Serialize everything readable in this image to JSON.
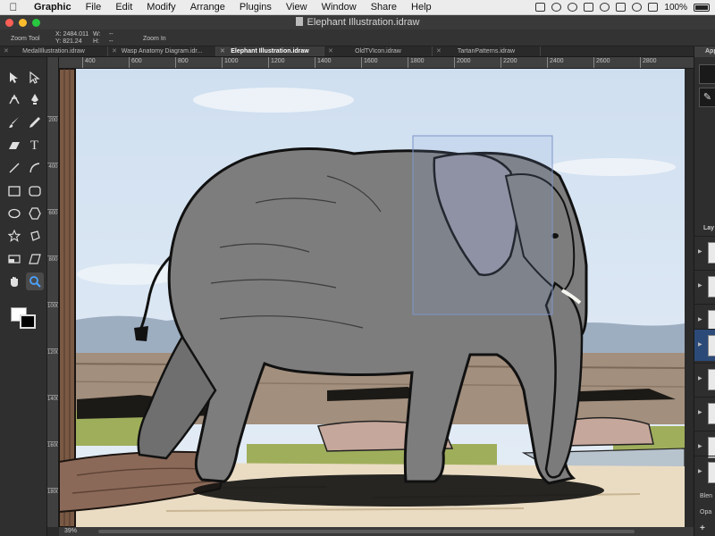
{
  "menubar": {
    "apple": "",
    "items": [
      "Graphic",
      "File",
      "Edit",
      "Modify",
      "Arrange",
      "Plugins",
      "View",
      "Window",
      "Share",
      "Help"
    ],
    "battery": "100%"
  },
  "window": {
    "title": "Elephant Illustration.idraw"
  },
  "infobar": {
    "tool_name": "Zoom Tool",
    "x_label": "X:",
    "x_value": "2484.011",
    "y_label": "Y:",
    "y_value": "821.24",
    "w_label": "W:",
    "w_value": "--",
    "h_label": "H:",
    "h_value": "--",
    "zoom_action": "Zoom In"
  },
  "tabs": [
    {
      "label": "MedalIllustration.idraw",
      "active": false
    },
    {
      "label": "Wasp Anatomy Diagram.idr...",
      "active": false
    },
    {
      "label": "Elephant Illustration.idraw",
      "active": true
    },
    {
      "label": "OldTVIcon.idraw",
      "active": false
    },
    {
      "label": "TartanPatterns.idraw",
      "active": false
    }
  ],
  "hruler_labels": [
    "400",
    "600",
    "800",
    "1000",
    "1200",
    "1400",
    "1600",
    "1800",
    "2000",
    "2200",
    "2400",
    "2600",
    "2800"
  ],
  "vruler_labels": [
    "200",
    "400",
    "600",
    "800",
    "1000",
    "1200",
    "1400",
    "1600",
    "1800",
    "2000"
  ],
  "tools": [
    [
      "pointer-tool",
      "direct-select-tool"
    ],
    [
      "node-tool",
      "pen-tool"
    ],
    [
      "brush-tool",
      "pencil-tool"
    ],
    [
      "eraser-tool",
      "text-tool"
    ],
    [
      "line-tool",
      "arc-tool"
    ],
    [
      "rectangle-tool",
      "rounded-rect-tool"
    ],
    [
      "ellipse-tool",
      "polygon-tool"
    ],
    [
      "star-tool",
      "rotate-tool"
    ],
    [
      "crop-tool",
      "shear-tool"
    ],
    [
      "hand-tool",
      "zoom-tool"
    ]
  ],
  "right_panel": {
    "header": "App",
    "layers_label": "Lay",
    "blend_label": "Blen",
    "opacity_label": "Opa",
    "add_label": "+"
  },
  "status": {
    "zoom": "39%"
  },
  "colors": {
    "accent": "#2b4a78",
    "sky": "#dce8f3",
    "elephant": "#7d7d7d"
  }
}
